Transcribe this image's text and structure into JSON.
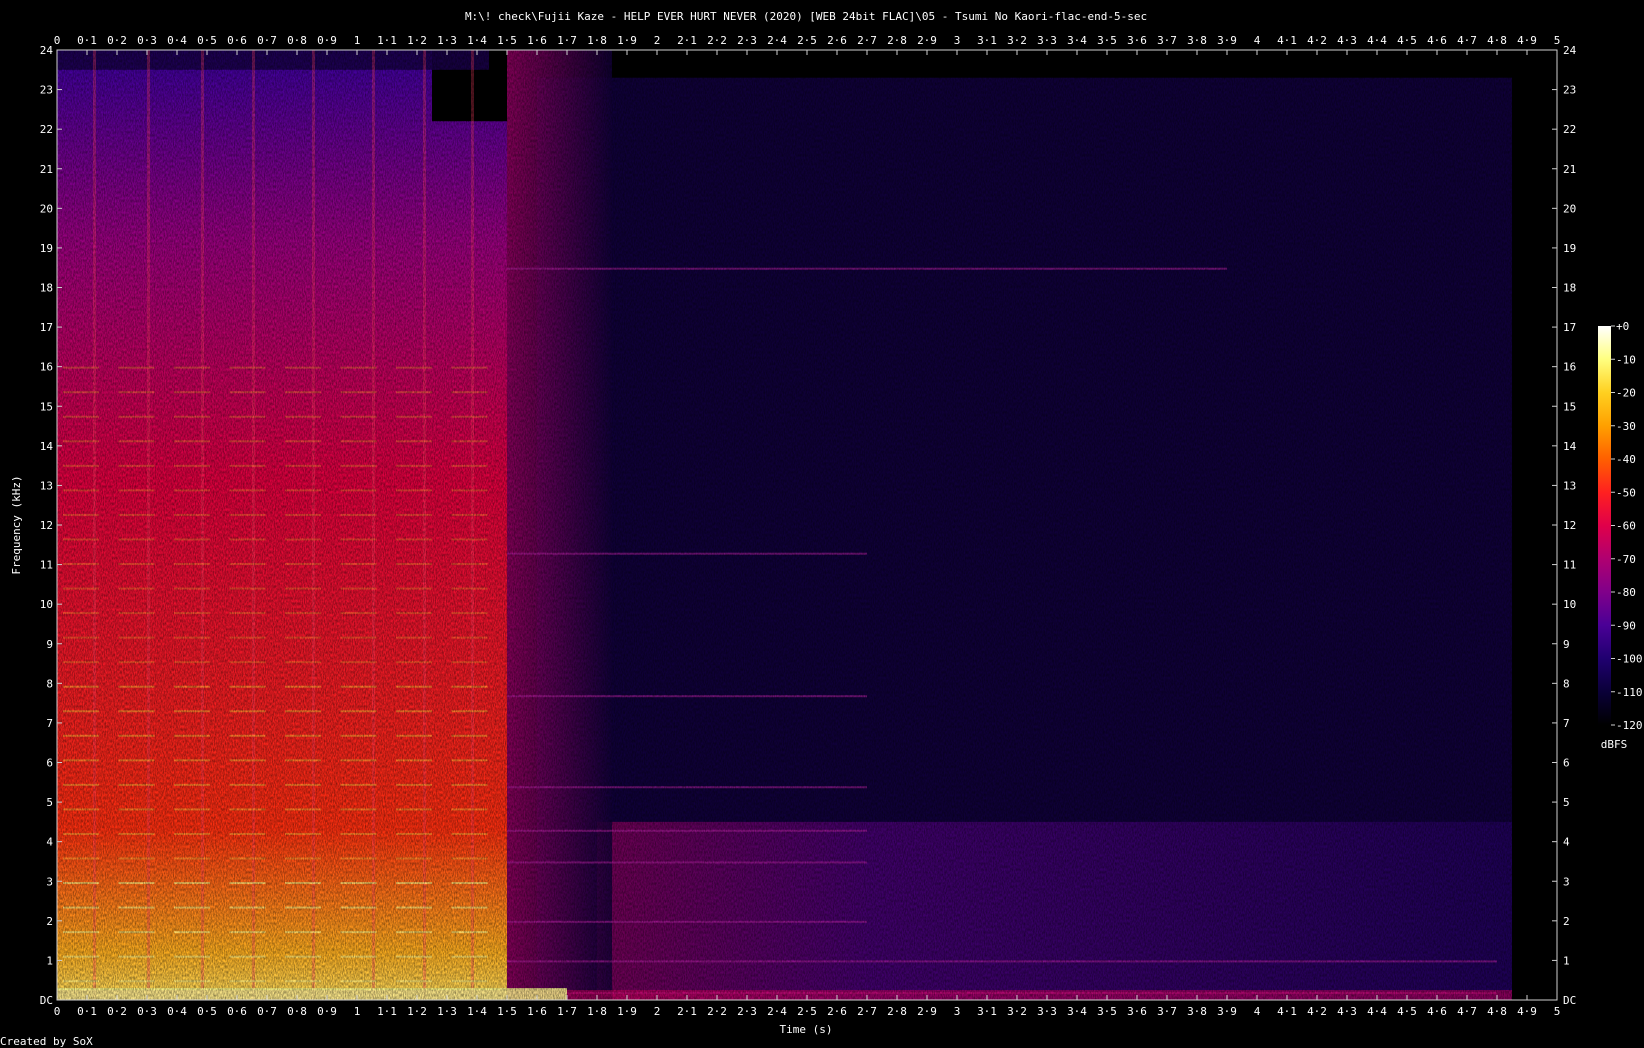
{
  "chart_data": {
    "type": "heatmap",
    "title": "M:\\! check\\Fujii Kaze - HELP EVER HURT NEVER (2020) [WEB 24bit FLAC]\\05 - Tsumi No Kaori-flac-end-5-sec",
    "xlabel": "Time (s)",
    "ylabel": "Frequency (kHz)",
    "xlim": [
      0,
      5
    ],
    "ylim": [
      0,
      24
    ],
    "x_ticks": [
      "0",
      "0·1",
      "0·2",
      "0·3",
      "0·4",
      "0·5",
      "0·6",
      "0·7",
      "0·8",
      "0·9",
      "1",
      "1·1",
      "1·2",
      "1·3",
      "1·4",
      "1·5",
      "1·6",
      "1·7",
      "1·8",
      "1·9",
      "2",
      "2·1",
      "2·2",
      "2·3",
      "2·4",
      "2·5",
      "2·6",
      "2·7",
      "2·8",
      "2·9",
      "3",
      "3·1",
      "3·2",
      "3·3",
      "3·4",
      "3·5",
      "3·6",
      "3·7",
      "3·8",
      "3·9",
      "4",
      "4·1",
      "4·2",
      "4·3",
      "4·4",
      "4·5",
      "4·6",
      "4·7",
      "4·8",
      "4·9",
      "5"
    ],
    "y_ticks": [
      "DC",
      "1",
      "2",
      "3",
      "4",
      "5",
      "6",
      "7",
      "8",
      "9",
      "10",
      "11",
      "12",
      "13",
      "14",
      "15",
      "16",
      "17",
      "18",
      "19",
      "20",
      "21",
      "22",
      "23",
      "24"
    ],
    "colorbar": {
      "label": "dBFS",
      "range": [
        -120,
        0
      ],
      "ticks": [
        "+0",
        "-10",
        "-20",
        "-30",
        "-40",
        "-50",
        "-60",
        "-70",
        "-80",
        "-90",
        "-100",
        "-110",
        "-120"
      ],
      "colors": [
        "#ffffff",
        "#ffff80",
        "#ffd020",
        "#ffa000",
        "#ff6000",
        "#ff2020",
        "#e0004a",
        "#b00070",
        "#80008a",
        "#4a0096",
        "#200070",
        "#0a0038",
        "#000000"
      ]
    },
    "regions": [
      {
        "t_start": 0.0,
        "t_end": 1.5,
        "description_level_db": -40
      },
      {
        "t_start": 1.5,
        "t_end": 1.75,
        "description_level_db": -75
      },
      {
        "t_start": 1.75,
        "t_end": 4.85,
        "description_level_db": -100
      }
    ],
    "tonal_lines_khz": [
      0.2,
      1.0,
      2.0,
      3.5,
      4.3,
      5.4,
      7.7,
      11.3,
      18.5
    ],
    "footer": "Created by SoX"
  }
}
